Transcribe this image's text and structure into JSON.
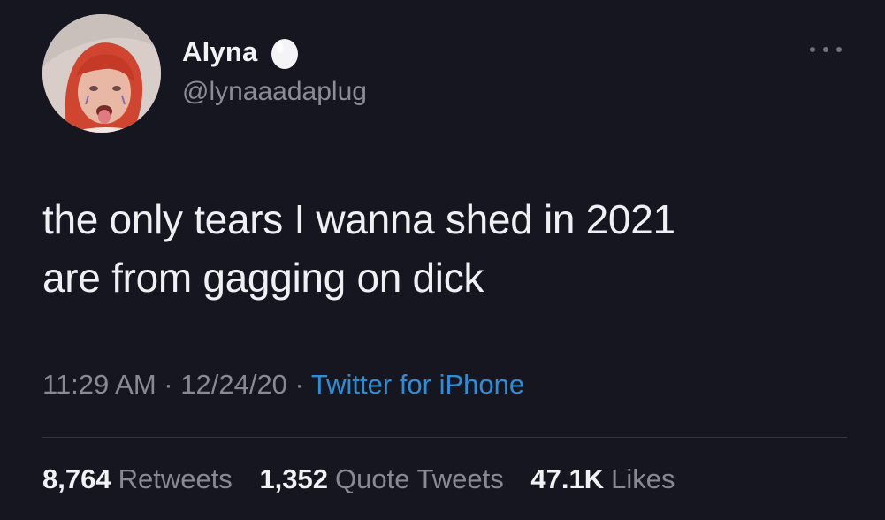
{
  "author": {
    "display_name": "Alyna",
    "handle": "@lynaaadaplug",
    "badge_icon": "egg-icon",
    "avatar_icon": "profile-photo"
  },
  "more_icon": "ellipsis-icon",
  "tweet": {
    "line1": "the only tears I wanna shed in 2021",
    "line2": "are from gagging on dick"
  },
  "meta": {
    "time": "11:29 AM",
    "sep1": " · ",
    "date": "12/24/20",
    "sep2": " · ",
    "source": "Twitter for iPhone"
  },
  "stats": [
    {
      "value": "8,764",
      "label": "Retweets"
    },
    {
      "value": "1,352",
      "label": "Quote Tweets"
    },
    {
      "value": "47.1K",
      "label": "Likes"
    }
  ],
  "colors": {
    "background": "#15161f",
    "link": "#2d8ed8",
    "muted": "#878a94",
    "text": "#eef0f3"
  }
}
